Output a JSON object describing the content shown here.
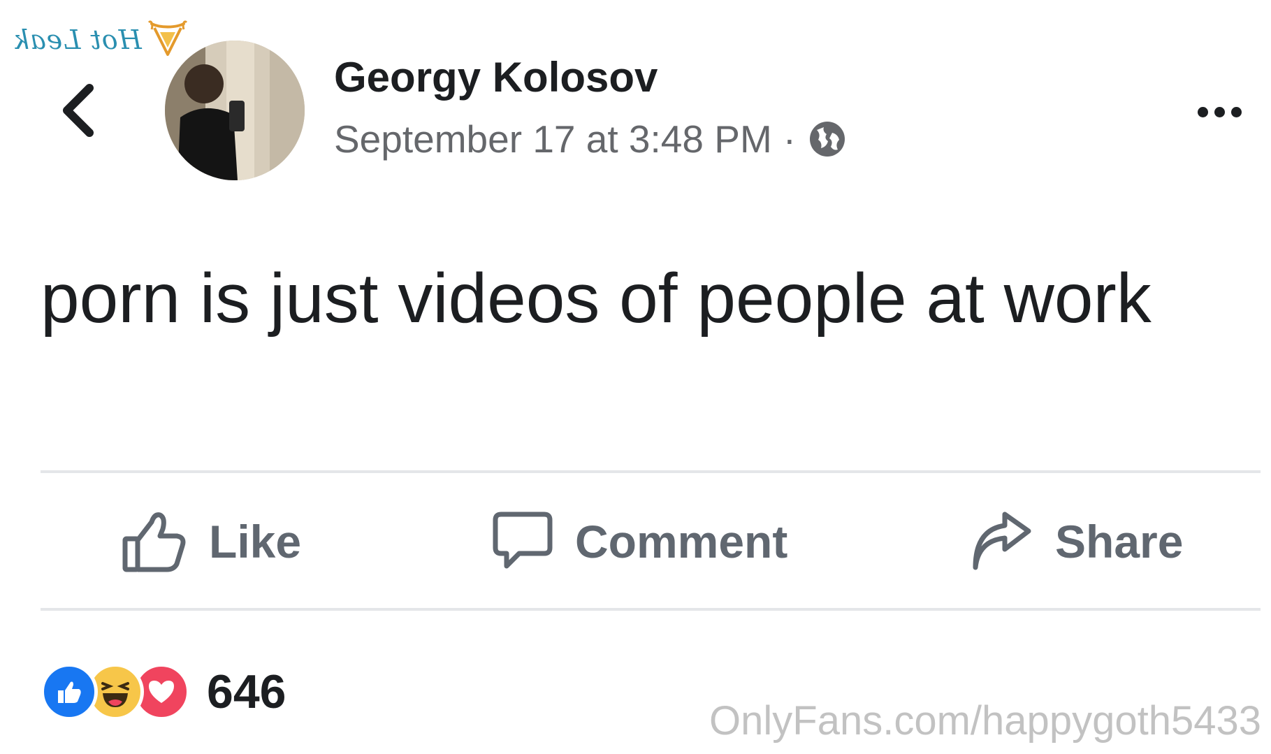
{
  "watermark": {
    "hot_leak": "Hot Leak",
    "onlyfans": "OnlyFans.com/happygoth5433"
  },
  "post": {
    "author": "Georgy Kolosov",
    "timestamp": "September 17 at 3:48 PM",
    "meta_separator": "·",
    "privacy_icon": "globe-icon",
    "text": "porn is just videos of people at work"
  },
  "actions": {
    "like_label": "Like",
    "comment_label": "Comment",
    "share_label": "Share"
  },
  "reactions": {
    "types": [
      "like",
      "haha",
      "love"
    ],
    "count": "646"
  },
  "colors": {
    "like_blue": "#1877f2",
    "haha_yellow": "#f7c649",
    "love_red": "#f0445e",
    "meta_gray": "#65676b",
    "action_gray": "#606770"
  }
}
